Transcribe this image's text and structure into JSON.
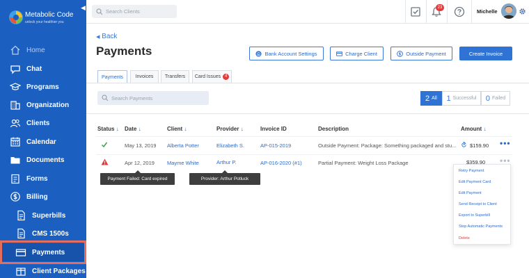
{
  "brand": {
    "name": "Metabolic Code",
    "tagline": "unlock your healthier you"
  },
  "sidebar": {
    "items": [
      {
        "label": "Home",
        "icon": "home-icon"
      },
      {
        "label": "Chat",
        "icon": "chat-icon"
      },
      {
        "label": "Programs",
        "icon": "graduation-cap-icon"
      },
      {
        "label": "Organization",
        "icon": "building-icon"
      },
      {
        "label": "Clients",
        "icon": "users-icon"
      },
      {
        "label": "Calendar",
        "icon": "calendar-icon"
      },
      {
        "label": "Documents",
        "icon": "folder-icon"
      },
      {
        "label": "Forms",
        "icon": "clipboard-icon"
      },
      {
        "label": "Billing",
        "icon": "dollar-icon"
      },
      {
        "label": "Superbills",
        "icon": "document-icon"
      },
      {
        "label": "CMS 1500s",
        "icon": "document-icon"
      },
      {
        "label": "Payments",
        "icon": "card-icon"
      },
      {
        "label": "Client Packages",
        "icon": "package-icon"
      }
    ],
    "active": "Payments"
  },
  "topbar": {
    "search_placeholder": "Search Clients",
    "notification_count": "23",
    "user_name": "Michelle"
  },
  "page": {
    "back_label": "Back",
    "title": "Payments",
    "buttons": {
      "bank": "Bank Account Settings",
      "charge": "Charge Client",
      "outside": "Outside Payment",
      "create": "Create Invoice"
    },
    "tabs": [
      {
        "label": "Payments"
      },
      {
        "label": "Invoices"
      },
      {
        "label": "Transfers"
      },
      {
        "label": "Card Issues",
        "count": "4"
      }
    ],
    "search_placeholder": "Search Payments",
    "filters": [
      {
        "count": "2",
        "label": "All"
      },
      {
        "count": "1",
        "label": "Successful"
      },
      {
        "count": "0",
        "label": "Failed"
      }
    ]
  },
  "table": {
    "headers": [
      "Status",
      "Date",
      "Client",
      "Provider",
      "Invoice ID",
      "Description",
      "Amount"
    ],
    "rows": [
      {
        "status": "success",
        "date": "May 13, 2019",
        "client": "Alberta Potter",
        "provider": "Elizabeth S.",
        "invoice": "AP-015-2019",
        "description": "Outside Payment: Package: Something packaged and stu...",
        "amount": "$159.90"
      },
      {
        "status": "failed",
        "date": "Apr 12, 2019",
        "client": "Mayme White",
        "provider": "Arthur P.",
        "invoice": "AP-016-2020 (#1)",
        "description": "Partial Payment: Weight Loss Package",
        "amount": "$359.90"
      }
    ]
  },
  "tooltips": {
    "failed": "Payment Failed:  Card expired",
    "provider": "Provider: Arthur Potluck"
  },
  "context_menu": [
    "Retry Payment",
    "Edit Payment Card",
    "Edit Payment",
    "Send Receipt to Client",
    "Export to Superbill",
    "Stop Automatic Payments",
    "Delete"
  ],
  "colors": {
    "sidebar": "#1b5fc0",
    "accent": "#2f73d4",
    "link": "#2d6bc9",
    "danger": "#e23b3b",
    "success": "#3aa34a",
    "highlight_outline": "#e36e5e"
  }
}
